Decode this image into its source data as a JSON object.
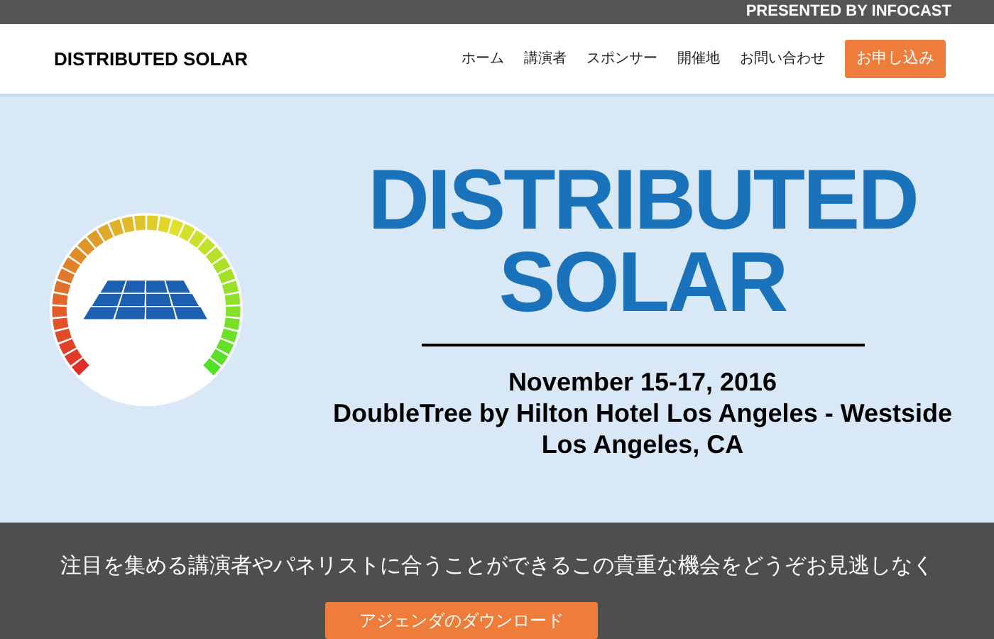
{
  "top_bar": {
    "text": "PRESENTED BY INFOCAST"
  },
  "header": {
    "logo": "DISTRIBUTED SOLAR",
    "nav": [
      {
        "label": "ホーム",
        "kind": "link"
      },
      {
        "label": "講演者",
        "kind": "link"
      },
      {
        "label": "スポンサー",
        "kind": "link"
      },
      {
        "label": "開催地",
        "kind": "link"
      },
      {
        "label": "お問い合わせ",
        "kind": "link"
      },
      {
        "label": "お申し込み",
        "kind": "button"
      }
    ]
  },
  "hero": {
    "title_lines": [
      "DISTRIBUTED",
      "SOLAR"
    ],
    "details": [
      "November 15-17, 2016",
      "DoubleTree by Hilton Hotel Los Angeles - Westside",
      "Los Angeles, CA"
    ]
  },
  "band": {
    "text": "注目を集める講演者やパネリストに合うことができるこの貴重な機会をどうぞお見逃しなく",
    "button": "アジェンダのダウンロード"
  }
}
